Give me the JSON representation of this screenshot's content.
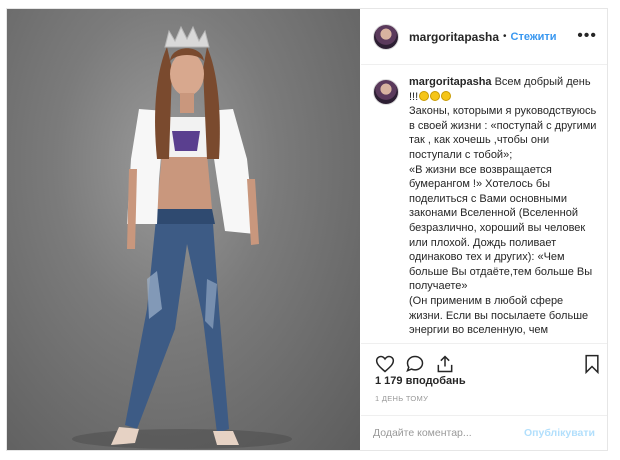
{
  "post": {
    "username": "margoritapasha",
    "separator": "•",
    "follow_label": "Стежити",
    "more_icon": "•••",
    "caption_username": "margoritapasha",
    "caption_text": " Всем добрый день !!!",
    "caption_body": "Законы, которыми я руководствуюсь в своей жизни : «поступай с другими так , как хочешь ,чтобы они поступали с тобой»;\n«В жизни все возвращается бумерангом !» Хотелось бы поделиться с Вами основными законами Вселенной (Вселенной безразлично, хороший вы человек или плохой. Дождь поливает одинаково тех и других): «Чем больше Вы отдаёте,тем больше Вы получаете»\n(Он применим в любой сфере жизни. Если вы посылаете больше энергии во вселенную, чем",
    "likes": "1 179 вподобань",
    "time": "1 ДЕНЬ ТОМУ",
    "comment_placeholder": "Додайте коментар...",
    "publish_label": "Опублікувати"
  },
  "colors": {
    "accent": "#3897f0",
    "publish_disabled": "#b2dffc",
    "photo_bg": "#7b7b7b"
  },
  "icons": [
    "heart-icon",
    "comment-icon",
    "share-icon",
    "bookmark-icon",
    "more-icon",
    "emoji-icon"
  ]
}
